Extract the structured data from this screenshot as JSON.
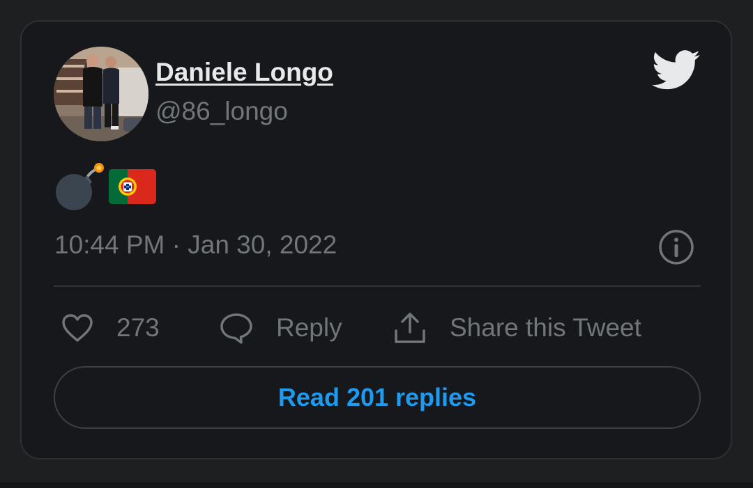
{
  "tweet": {
    "author": {
      "display_name": "Daniele Longo",
      "handle": "@86_longo"
    },
    "content_emoji": [
      "bomb",
      "portugal-flag"
    ],
    "timestamp": "10:44 PM · Jan 30, 2022",
    "likes": "273",
    "reply_label": "Reply",
    "share_label": "Share this Tweet",
    "read_replies_label": "Read 201 replies"
  },
  "icons": {
    "logo": "twitter-bird-icon",
    "info": "info-icon",
    "like": "heart-icon",
    "reply": "speech-bubble-icon",
    "share": "share-upload-icon"
  },
  "colors": {
    "card_background": "#16181c",
    "page_background": "#1e1f20",
    "primary_text": "#e7e9ea",
    "secondary_text": "#71767b",
    "accent": "#1d9bf0"
  }
}
